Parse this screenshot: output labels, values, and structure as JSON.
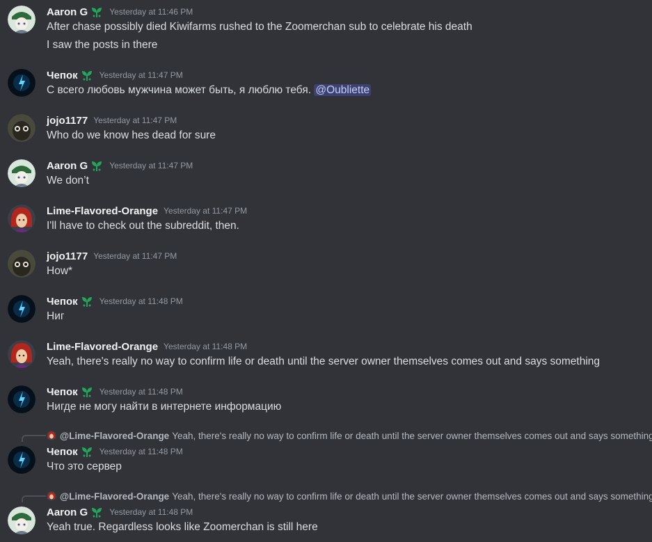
{
  "colors": {
    "background": "#313338",
    "username": "#f2f3f5",
    "timestamp": "#949ba4",
    "text": "#dbdee1",
    "mention_bg": "#3c4270",
    "mention_fg": "#c9cdfb",
    "badge": "#23a55a"
  },
  "messages": [
    {
      "id": "m1",
      "avatar": "aaron-avatar",
      "author": "Aaron G",
      "badge": true,
      "timestamp": "Yesterday at 11:46 PM",
      "lines": [
        "After chase possibly died Kiwifarms rushed to the Zoomerchan sub to celebrate his death",
        "I saw the posts in there"
      ]
    },
    {
      "id": "m2",
      "avatar": "chepok-avatar",
      "author": "Чепок",
      "badge": true,
      "timestamp": "Yesterday at 11:47 PM",
      "lines": [
        "С всего любовь мужчина может быть, я люблю тебя."
      ],
      "mention": "@Oubliette"
    },
    {
      "id": "m3",
      "avatar": "jojo-avatar",
      "author": "jojo1177",
      "badge": false,
      "timestamp": "Yesterday at 11:47 PM",
      "lines": [
        "Who do we know hes dead for sure"
      ]
    },
    {
      "id": "m4",
      "avatar": "aaron-avatar",
      "author": "Aaron G",
      "badge": true,
      "timestamp": "Yesterday at 11:47 PM",
      "lines": [
        "We don’t"
      ]
    },
    {
      "id": "m5",
      "avatar": "lime-avatar",
      "author": "Lime-Flavored-Orange",
      "badge": false,
      "timestamp": "Yesterday at 11:47 PM",
      "lines": [
        "I'll have to check out the subreddit, then."
      ]
    },
    {
      "id": "m6",
      "avatar": "jojo-avatar",
      "author": "jojo1177",
      "badge": false,
      "timestamp": "Yesterday at 11:47 PM",
      "lines": [
        "How*"
      ]
    },
    {
      "id": "m7",
      "avatar": "chepok-avatar",
      "author": "Чепок",
      "badge": true,
      "timestamp": "Yesterday at 11:48 PM",
      "lines": [
        "Ниг"
      ]
    },
    {
      "id": "m8",
      "avatar": "lime-avatar",
      "author": "Lime-Flavored-Orange",
      "badge": false,
      "timestamp": "Yesterday at 11:48 PM",
      "lines": [
        "Yeah, there's really no way to confirm life or death until the server owner themselves comes out and says something"
      ]
    },
    {
      "id": "m9",
      "avatar": "chepok-avatar",
      "author": "Чепок",
      "badge": true,
      "timestamp": "Yesterday at 11:48 PM",
      "lines": [
        "Нигде не могу найти в интернете информацию"
      ]
    },
    {
      "id": "m10",
      "avatar": "chepok-avatar",
      "author": "Чепок",
      "badge": true,
      "timestamp": "Yesterday at 11:48 PM",
      "reply": {
        "author": "@Lime-Flavored-Orange",
        "text": "Yeah, there's really no way to confirm life or death until the server owner themselves comes out and says something"
      },
      "lines": [
        "Что это сервер"
      ]
    },
    {
      "id": "m11",
      "avatar": "aaron-avatar",
      "author": "Aaron G",
      "badge": true,
      "timestamp": "Yesterday at 11:48 PM",
      "reply": {
        "author": "@Lime-Flavored-Orange",
        "text": "Yeah, there's really no way to confirm life or death until the server owner themselves comes out and says something"
      },
      "lines": [
        "Yeah true. Regardless looks like Zoomerchan is still here"
      ]
    }
  ]
}
